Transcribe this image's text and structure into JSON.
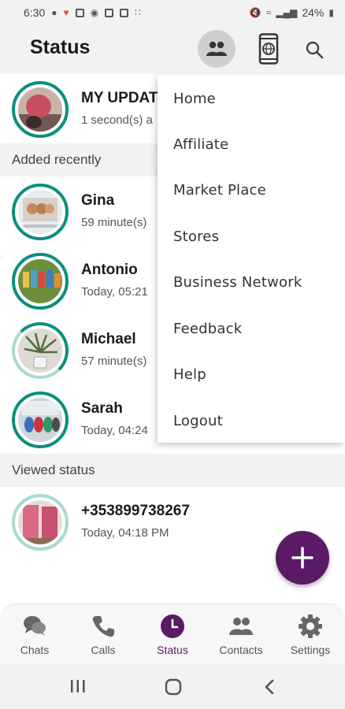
{
  "status_bar": {
    "time": "6:30",
    "battery": "24%"
  },
  "app_bar": {
    "title": "Status"
  },
  "my_update": {
    "name": "MY UPDAT",
    "time": "1 second(s) a"
  },
  "sections": {
    "recent": "Added recently",
    "viewed": "Viewed status"
  },
  "recent": [
    {
      "name": "Gina",
      "time": "59 minute(s)"
    },
    {
      "name": "Antonio",
      "time": "Today, 05:21"
    },
    {
      "name": "Michael",
      "time": "57 minute(s)"
    },
    {
      "name": "Sarah",
      "time": "Today, 04:24"
    }
  ],
  "viewed": [
    {
      "name": "+353899738267",
      "time": "Today, 04:18 PM"
    }
  ],
  "menu": [
    "Home",
    "Affiliate",
    "Market Place",
    "Stores",
    "Business Network",
    "Feedback",
    "Help",
    "Logout"
  ],
  "bottom_nav": [
    {
      "label": "Chats",
      "icon": "chat-icon"
    },
    {
      "label": "Calls",
      "icon": "phone-icon"
    },
    {
      "label": "Status",
      "icon": "clock-icon",
      "active": true
    },
    {
      "label": "Contacts",
      "icon": "contacts-icon"
    },
    {
      "label": "Settings",
      "icon": "gear-icon"
    }
  ],
  "colors": {
    "accent": "#5b1a66",
    "ring": "#0b8f7e",
    "ring_viewed": "#a9d9d1"
  }
}
